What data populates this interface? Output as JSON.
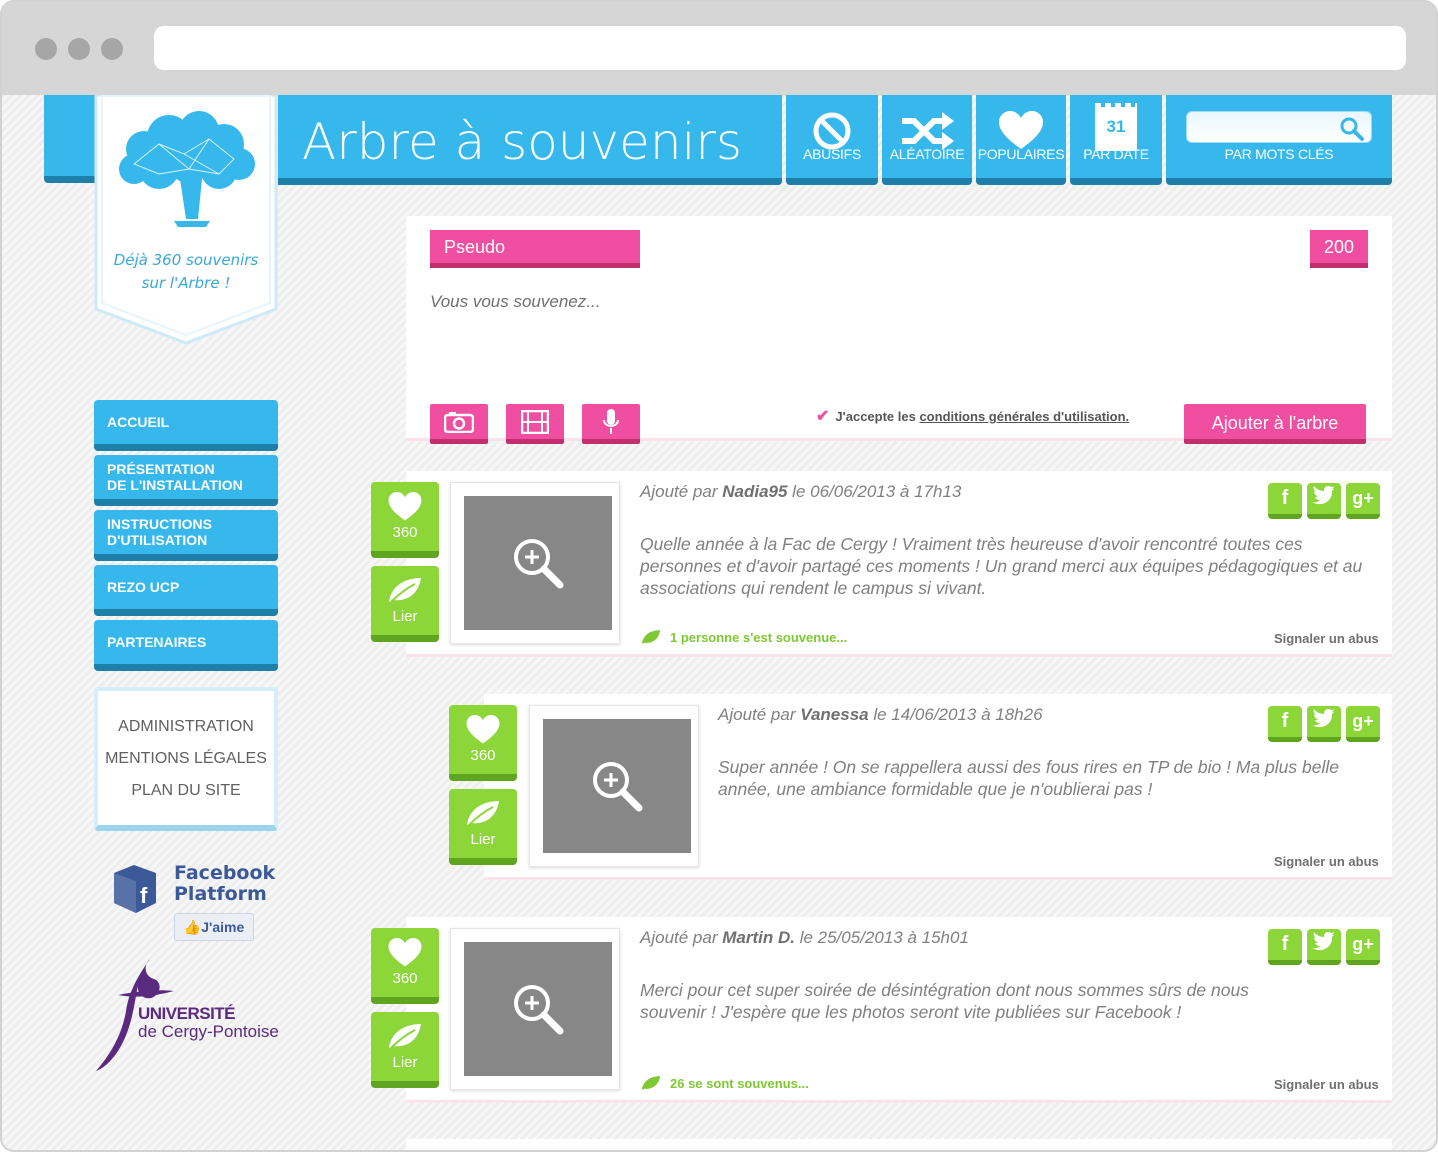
{
  "site": {
    "title": "Arbre à souvenirs",
    "counter_line1": "Déjà 360 souvenirs",
    "counter_line2": "sur l'Arbre !"
  },
  "nav": [
    {
      "label": "ABUSIFS",
      "icon": "ban-icon"
    },
    {
      "label": "ALÉATOIRE",
      "icon": "shuffle-icon"
    },
    {
      "label": "POPULAIRES",
      "icon": "heart-icon"
    },
    {
      "label": "PAR DATE",
      "icon": "calendar-icon",
      "day": "31"
    },
    {
      "label": "PAR MOTS CLÉS",
      "icon": "search-icon",
      "search_value": ""
    }
  ],
  "menu": [
    {
      "line1": "ACCUEIL",
      "line2": ""
    },
    {
      "line1": "PRÉSENTATION",
      "line2": "DE L'INSTALLATION"
    },
    {
      "line1": "INSTRUCTIONS",
      "line2": "D'UTILISATION"
    },
    {
      "line1": "REZO UCP",
      "line2": ""
    },
    {
      "line1": "PARTENAIRES",
      "line2": ""
    }
  ],
  "secondary_links": [
    "ADMINISTRATION",
    "MENTIONS LÉGALES",
    "PLAN DU SITE"
  ],
  "facebook": {
    "line1": "Facebook",
    "line2": "Platform",
    "like": "J'aime"
  },
  "university": {
    "line1": "UNIVERSITÉ",
    "line2": "de Cergy-Pontoise"
  },
  "form": {
    "pseudo_placeholder": "Pseudo",
    "char_count": "200",
    "memory_placeholder": "Vous vous souvenez...",
    "accept_prefix": "J'accepte les ",
    "accept_link": "conditions générales d'utilisation.",
    "submit_label": "Ajouter à l'arbre"
  },
  "posts": [
    {
      "prefix": "Ajouté par ",
      "author": "Nadia95",
      "date": " le 06/06/2013 à 17h13",
      "text": "Quelle année à la Fac de Cergy ! Vraiment très heureuse d'avoir rencontré toutes ces personnes et d'avoir partagé ces moments ! Un grand merci aux équipes pédagogiques et au associations qui rendent le campus si vivant.",
      "likes": "360",
      "link_label": "Lier",
      "remembered": "1 personne s'est souvenue...",
      "report": "Signaler un abus"
    },
    {
      "prefix": "Ajouté par ",
      "author": "Vanessa",
      "date": " le 14/06/2013 à 18h26",
      "text": "Super année ! On se rappellera aussi des fous rires en TP de bio ! Ma plus belle année, une ambiance formidable que je n'oublierai pas !",
      "likes": "360",
      "link_label": "Lier",
      "remembered": "",
      "report": "Signaler un abus"
    },
    {
      "prefix": "Ajouté par ",
      "author": "Martin D.",
      "date": " le 25/05/2013 à 15h01",
      "text": "Merci pour cet super soirée de désintégration dont nous sommes sûrs de nous souvenir ! J'espère que les photos seront vite publiées sur Facebook !",
      "likes": "360",
      "link_label": "Lier",
      "remembered": "26 se sont souvenus...",
      "report": "Signaler un abus"
    }
  ],
  "social": [
    "f",
    "twitter",
    "g+"
  ],
  "colors": {
    "blue": "#37b8ec",
    "blue_dark": "#1e7fa8",
    "pink": "#f04ea0",
    "green": "#8cd63a"
  }
}
